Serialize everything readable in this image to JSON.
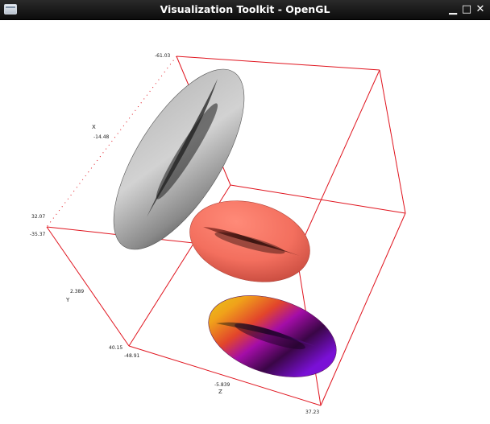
{
  "window": {
    "title": "Visualization Toolkit - OpenGL",
    "controls": {
      "minimize": "▁",
      "maximize": "□",
      "close": "✕"
    }
  },
  "axes": {
    "x_title": "X",
    "y_title": "Y",
    "z_title": "Z",
    "x_ticks": [
      "-61.03",
      "-14.48",
      "32.07"
    ],
    "y_ticks": [
      "-35.37",
      "2.389",
      "40.15"
    ],
    "z_ticks": [
      "-48.91",
      "-5.839",
      "37.23"
    ]
  },
  "colors": {
    "bounding_box": "#e0141e",
    "titlebar": "#111111",
    "background": "#ffffff"
  },
  "objects": [
    {
      "name": "Gray shaded torus",
      "color": "gray"
    },
    {
      "name": "Salmon shaded torus",
      "color": "salmon"
    },
    {
      "name": "Rainbow colormapped torus",
      "color": "purple-orange-yellow"
    }
  ]
}
